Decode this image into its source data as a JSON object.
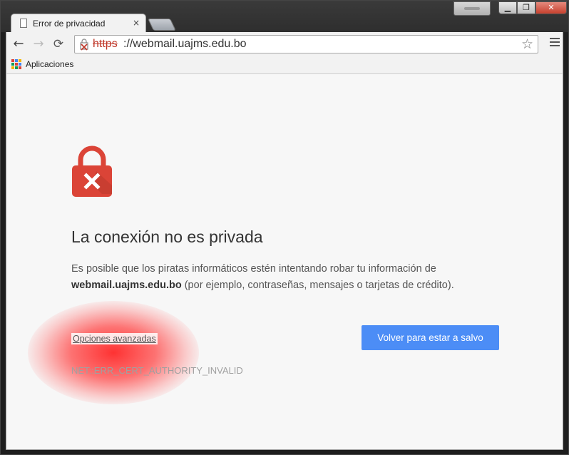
{
  "window": {
    "controls": {
      "minimize": "▁",
      "maximize": "❐",
      "close": "✕"
    }
  },
  "tab": {
    "title": "Error de privacidad",
    "close": "×",
    "icon": "page-icon"
  },
  "toolbar": {
    "back": "←",
    "forward": "→",
    "reload": "⟳",
    "url_scheme": "https",
    "url_rest": "://webmail.uajms.edu.bo",
    "star": "☆"
  },
  "bookmarks": {
    "apps_label": "Aplicaciones"
  },
  "page": {
    "heading": "La conexión no es privada",
    "desc_prefix": "Es posible que los piratas informáticos estén intentando robar tu información de",
    "domain": "webmail.uajms.edu.bo",
    "desc_suffix": " (por ejemplo, contraseñas, mensajes o tarjetas de crédito).",
    "advanced_link": "Opciones avanzadas",
    "safe_button": "Volver para estar a salvo",
    "error_code": "NET::ERR_CERT_AUTHORITY_INVALID",
    "lock_color": "#db4437"
  },
  "colors": {
    "accent_button": "#4c8df6",
    "error_red": "#c0392b"
  }
}
